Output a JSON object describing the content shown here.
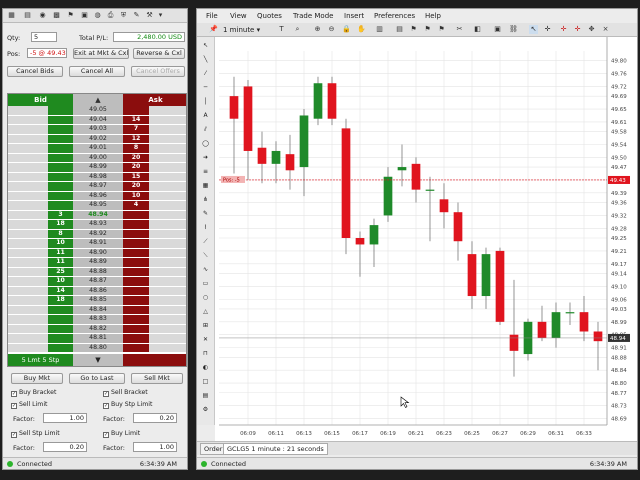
{
  "dom_trader": {
    "qty_label": "Qty:",
    "qty_value": "5",
    "total_pl_label": "Total P/L:",
    "total_pl_value": "2,480.00 USD",
    "pos_label": "Pos:",
    "pos_value": "-5 @ 49.43",
    "exit_button": "Exit at Mkt & Cxl",
    "reverse_button": "Reverse & Cxl",
    "cancel_bids": "Cancel Bids",
    "cancel_all": "Cancel All",
    "cancel_offers": "Cancel Offers",
    "bid_header": "Bid",
    "ask_header": "Ask",
    "rows": [
      {
        "bid": "",
        "price": "49.05",
        "ask": ""
      },
      {
        "bid": "",
        "price": "49.04",
        "ask": "14"
      },
      {
        "bid": "",
        "price": "49.03",
        "ask": "7"
      },
      {
        "bid": "",
        "price": "49.02",
        "ask": "12"
      },
      {
        "bid": "",
        "price": "49.01",
        "ask": "8"
      },
      {
        "bid": "",
        "price": "49.00",
        "ask": "20"
      },
      {
        "bid": "",
        "price": "48.99",
        "ask": "20"
      },
      {
        "bid": "",
        "price": "48.98",
        "ask": "15"
      },
      {
        "bid": "",
        "price": "48.97",
        "ask": "20"
      },
      {
        "bid": "",
        "price": "48.96",
        "ask": "10"
      },
      {
        "bid": "",
        "price": "48.95",
        "ask": "4"
      },
      {
        "bid": "3",
        "price": "48.94",
        "ask": ""
      },
      {
        "bid": "18",
        "price": "48.93",
        "ask": ""
      },
      {
        "bid": "8",
        "price": "48.92",
        "ask": ""
      },
      {
        "bid": "10",
        "price": "48.91",
        "ask": ""
      },
      {
        "bid": "11",
        "price": "48.90",
        "ask": ""
      },
      {
        "bid": "11",
        "price": "48.89",
        "ask": ""
      },
      {
        "bid": "25",
        "price": "48.88",
        "ask": ""
      },
      {
        "bid": "10",
        "price": "48.87",
        "ask": ""
      },
      {
        "bid": "14",
        "price": "48.86",
        "ask": ""
      },
      {
        "bid": "18",
        "price": "48.85",
        "ask": ""
      },
      {
        "bid": "",
        "price": "48.84",
        "ask": ""
      },
      {
        "bid": "",
        "price": "48.83",
        "ask": ""
      },
      {
        "bid": "",
        "price": "48.82",
        "ask": ""
      },
      {
        "bid": "",
        "price": "48.81",
        "ask": ""
      },
      {
        "bid": "",
        "price": "48.80",
        "ask": ""
      }
    ],
    "footer_label": "5 Lmt 5 Stp",
    "buy_mkt": "Buy Mkt",
    "go_to_last": "Go to Last",
    "sell_mkt": "Sell Mkt",
    "buy_bracket": "Buy Bracket",
    "sell_bracket": "Sell Bracket",
    "sell_limit": "Sell Limit",
    "buy_stp_limit": "Buy Stp Limit",
    "sell_stp_limit": "Sell Stp Limit",
    "buy_limit": "Buy Limit",
    "factor_label": "Factor:",
    "factor1": "1.00",
    "factor2": "0.20",
    "factor3": "0.20",
    "factor4": "1.00",
    "status": "Connected",
    "time": "6:34:39 AM"
  },
  "chart_window": {
    "menu": [
      "File",
      "View",
      "Quotes",
      "Trade Mode",
      "Insert",
      "Preferences",
      "Help"
    ],
    "interval": "1 minute",
    "pos_marker": "Pos: -5",
    "tab_order": "Order",
    "tab_chart": "GCLG5 1 minute : 21 seconds",
    "status": "Connected",
    "time": "6:34:39 AM",
    "colors": {
      "up": "#1f8a2a",
      "down": "#e0141e",
      "pos_line": "#e0141e"
    }
  },
  "chart_data": {
    "type": "candlestick",
    "ylim": [
      48.67,
      49.83
    ],
    "y_ticks": [
      "49.80",
      "49.76",
      "49.72",
      "49.69",
      "49.65",
      "49.61",
      "49.58",
      "49.54",
      "49.50",
      "49.47",
      "49.43",
      "49.39",
      "49.36",
      "49.32",
      "49.28",
      "49.25",
      "49.21",
      "49.17",
      "49.14",
      "49.10",
      "49.06",
      "49.03",
      "48.99",
      "48.95",
      "48.91",
      "48.88",
      "48.84",
      "48.80",
      "48.77",
      "48.73",
      "48.69"
    ],
    "x_ticks": [
      "06:09",
      "06:11",
      "06:13",
      "06:15",
      "06:17",
      "06:19",
      "06:21",
      "06:23",
      "06:25",
      "06:27",
      "06:29",
      "06:31",
      "06:33"
    ],
    "x_tick_index": [
      1,
      3,
      5,
      7,
      9,
      11,
      13,
      15,
      17,
      19,
      21,
      23,
      25
    ],
    "candles": [
      {
        "o": 49.69,
        "h": 49.75,
        "l": 49.45,
        "c": 49.62
      },
      {
        "o": 49.72,
        "h": 49.74,
        "l": 49.43,
        "c": 49.52
      },
      {
        "o": 49.53,
        "h": 49.58,
        "l": 49.42,
        "c": 49.48
      },
      {
        "o": 49.48,
        "h": 49.55,
        "l": 49.42,
        "c": 49.52
      },
      {
        "o": 49.51,
        "h": 49.57,
        "l": 49.4,
        "c": 49.46
      },
      {
        "o": 49.47,
        "h": 49.65,
        "l": 49.38,
        "c": 49.63
      },
      {
        "o": 49.62,
        "h": 49.75,
        "l": 49.6,
        "c": 49.73
      },
      {
        "o": 49.73,
        "h": 49.75,
        "l": 49.6,
        "c": 49.62
      },
      {
        "o": 49.59,
        "h": 49.62,
        "l": 49.2,
        "c": 49.25
      },
      {
        "o": 49.25,
        "h": 49.27,
        "l": 49.13,
        "c": 49.23
      },
      {
        "o": 49.23,
        "h": 49.31,
        "l": 49.16,
        "c": 49.29
      },
      {
        "o": 49.32,
        "h": 49.47,
        "l": 49.3,
        "c": 49.44
      },
      {
        "o": 49.46,
        "h": 49.54,
        "l": 49.41,
        "c": 49.47
      },
      {
        "o": 49.48,
        "h": 49.5,
        "l": 49.36,
        "c": 49.4
      },
      {
        "o": 49.4,
        "h": 49.44,
        "l": 49.24,
        "c": 49.4
      },
      {
        "o": 49.37,
        "h": 49.42,
        "l": 49.28,
        "c": 49.33
      },
      {
        "o": 49.33,
        "h": 49.36,
        "l": 49.18,
        "c": 49.24
      },
      {
        "o": 49.2,
        "h": 49.24,
        "l": 49.03,
        "c": 49.07
      },
      {
        "o": 49.07,
        "h": 49.22,
        "l": 49.03,
        "c": 49.2
      },
      {
        "o": 49.21,
        "h": 49.22,
        "l": 48.98,
        "c": 48.99
      },
      {
        "o": 48.95,
        "h": 49.12,
        "l": 48.82,
        "c": 48.9
      },
      {
        "o": 48.89,
        "h": 49.0,
        "l": 48.87,
        "c": 48.99
      },
      {
        "o": 48.99,
        "h": 49.04,
        "l": 48.93,
        "c": 48.94
      },
      {
        "o": 48.94,
        "h": 49.05,
        "l": 48.91,
        "c": 49.02
      },
      {
        "o": 49.02,
        "h": 49.05,
        "l": 48.98,
        "c": 49.02
      },
      {
        "o": 49.02,
        "h": 49.07,
        "l": 48.93,
        "c": 48.96
      },
      {
        "o": 48.96,
        "h": 48.99,
        "l": 48.84,
        "c": 48.93
      }
    ],
    "position_price": 49.43,
    "position_label": "49.43",
    "last_price": 48.94,
    "last_label": "48.94"
  }
}
